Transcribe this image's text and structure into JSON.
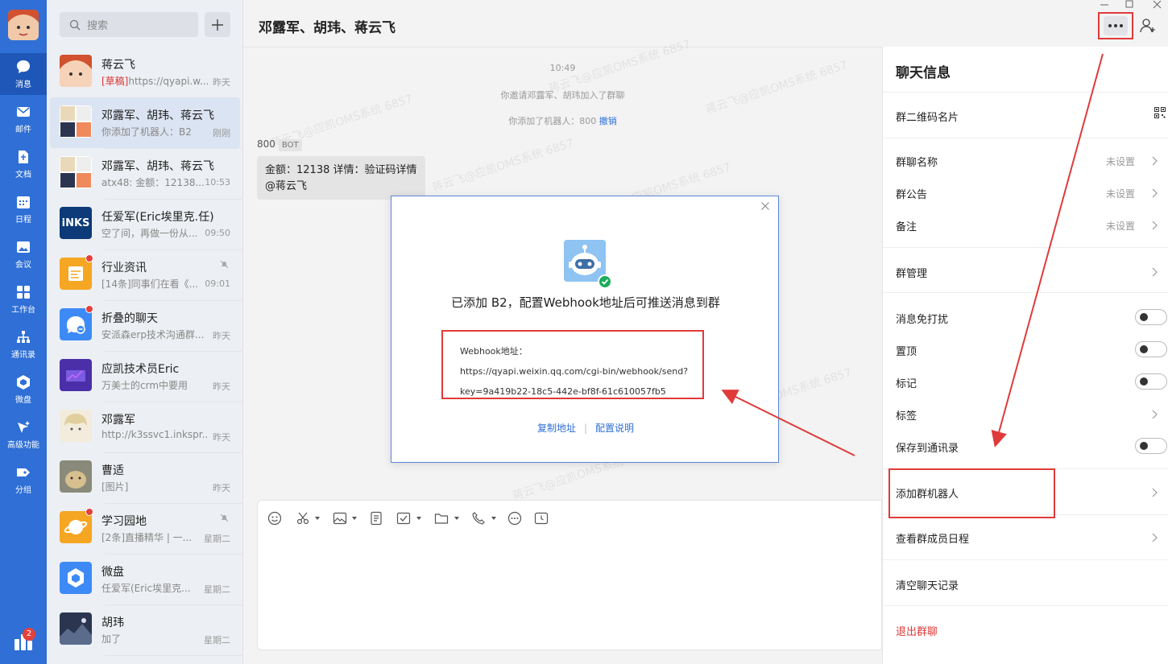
{
  "nav": {
    "items": [
      {
        "label": "消息",
        "icon": "chat-bubble-icon"
      },
      {
        "label": "邮件",
        "icon": "mail-icon"
      },
      {
        "label": "文档",
        "icon": "document-icon"
      },
      {
        "label": "日程",
        "icon": "calendar-icon"
      },
      {
        "label": "会议",
        "icon": "meeting-icon"
      },
      {
        "label": "工作台",
        "icon": "grid-icon"
      },
      {
        "label": "通讯录",
        "icon": "contacts-icon"
      },
      {
        "label": "微盘",
        "icon": "drive-icon"
      },
      {
        "label": "高级功能",
        "icon": "sparkle-icon"
      },
      {
        "label": "分组",
        "icon": "tag-icon"
      }
    ],
    "badge": "2"
  },
  "search": {
    "placeholder": "搜索"
  },
  "conversations": [
    {
      "name": "蒋云飞",
      "draft": "[草稿]",
      "preview": "https://qyapi.w...",
      "time": "昨天",
      "avatar": "#f08a5d"
    },
    {
      "name": "邓露军、胡玮、蒋云飞",
      "preview": "你添加了机器人：B2",
      "time": "刚刚",
      "avatar": "#c9b8a2"
    },
    {
      "name": "邓露军、胡玮、蒋云飞",
      "preview": "atx48: 金额：12138...",
      "time": "10:53",
      "avatar": "#c9b8a2"
    },
    {
      "name": "任爱军(Eric埃里克.任)",
      "preview": "空了间，再做一份从...",
      "time": "09:50",
      "avatar": "#0d3a78"
    },
    {
      "name": "行业资讯",
      "preview": "[14条]同事们在看《...",
      "time": "09:01",
      "avatar": "#f5a623"
    },
    {
      "name": "折叠的聊天",
      "preview": "安派森erp技术沟通群...",
      "time": "昨天",
      "avatar": "#3d8af7"
    },
    {
      "name": "应凯技术员Eric",
      "preview": "万美士的crm中要用",
      "time": "昨天",
      "avatar": "#4b2fa8"
    },
    {
      "name": "邓露军",
      "preview": "http://k3ssvc1.inkspr...",
      "time": "昨天",
      "avatar": "#e9d9b9"
    },
    {
      "name": "曹适",
      "preview": "[图片]",
      "time": "昨天",
      "avatar": "#b89b6e"
    },
    {
      "name": "学习园地",
      "preview": "[2条]直播精华 | 一...",
      "time": "星期二",
      "avatar": "#f5a623"
    },
    {
      "name": "微盘",
      "preview": "任爱军(Eric埃里克...",
      "time": "星期二",
      "avatar": "#3d8af7"
    },
    {
      "name": "胡玮",
      "preview": "加了",
      "time": "星期二",
      "avatar": "#2b3550"
    }
  ],
  "chat": {
    "title": "邓露军、胡玮、蒋云飞",
    "time": "10:49",
    "sys1": "你邀请邓露军、胡玮加入了群聊",
    "sys2": "你添加了机器人：800",
    "sys2_link": "撤销",
    "sender": "800",
    "bot_tag": "BOT",
    "bubble_line1": "金额：12138  详情：验证码详情",
    "bubble_line2": "@蒋云飞",
    "watermark": "蒋云飞@应凯OMS系统 6857"
  },
  "dialog": {
    "message": "已添加 B2，配置Webhook地址后可推送消息到群",
    "hook_label": "Webhook地址：",
    "hook_url1": "https://qyapi.weixin.qq.com/cgi-bin/webhook/send?",
    "hook_url2": "key=9a419b22-18c5-442e-bf8f-61c610057fb5",
    "copy": "复制地址",
    "help": "配置说明"
  },
  "panel": {
    "title": "聊天信息",
    "qr": "群二维码名片",
    "group_name": "群聊名称",
    "notice": "群公告",
    "remark": "备注",
    "unset": "未设置",
    "manage": "群管理",
    "dnd": "消息免打扰",
    "pin": "置顶",
    "mark": "标记",
    "tags": "标签",
    "save_contacts": "保存到通讯录",
    "add_robot": "添加群机器人",
    "schedule": "查看群成员日程",
    "clear": "清空聊天记录",
    "exit": "退出群聊"
  },
  "colors": {
    "accent": "#2f6fd6",
    "highlight": "#e03a3a"
  }
}
